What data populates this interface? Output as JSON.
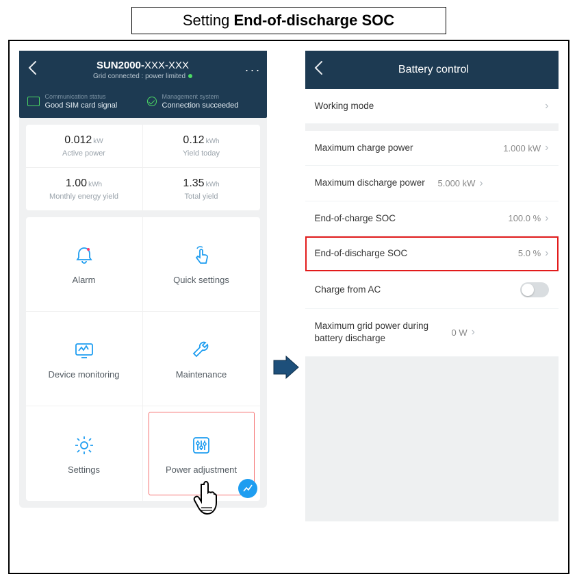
{
  "figure": {
    "prefix": "Setting ",
    "bold": "End-of-discharge SOC"
  },
  "left": {
    "header": {
      "title_prefix": "SUN2000-",
      "title_suffix": "XXX-XXX",
      "subtitle": "Grid connected : power limited"
    },
    "status": {
      "comm_label": "Communication status",
      "comm_value": "Good SIM card signal",
      "mgmt_label": "Management system",
      "mgmt_value": "Connection succeeded"
    },
    "stats": [
      {
        "value": "0.012",
        "unit": "kW",
        "label": "Active power"
      },
      {
        "value": "0.12",
        "unit": "kWh",
        "label": "Yield today"
      },
      {
        "value": "1.00",
        "unit": "kWh",
        "label": "Monthly energy yield"
      },
      {
        "value": "1.35",
        "unit": "kWh",
        "label": "Total yield"
      }
    ],
    "menu": [
      {
        "label": "Alarm"
      },
      {
        "label": "Quick settings"
      },
      {
        "label": "Device monitoring"
      },
      {
        "label": "Maintenance"
      },
      {
        "label": "Settings"
      },
      {
        "label": "Power adjustment"
      }
    ]
  },
  "right": {
    "title": "Battery control",
    "working_mode": "Working mode",
    "rows": [
      {
        "label": "Maximum charge power",
        "value": "1.000 kW"
      },
      {
        "label": "Maximum discharge power",
        "value": "5.000 kW"
      },
      {
        "label": "End-of-charge SOC",
        "value": "100.0 %"
      },
      {
        "label": "End-of-discharge SOC",
        "value": "5.0 %"
      },
      {
        "label": "Charge from AC",
        "value": ""
      },
      {
        "label": "Maximum grid power during battery discharge",
        "value": "0 W"
      }
    ]
  }
}
